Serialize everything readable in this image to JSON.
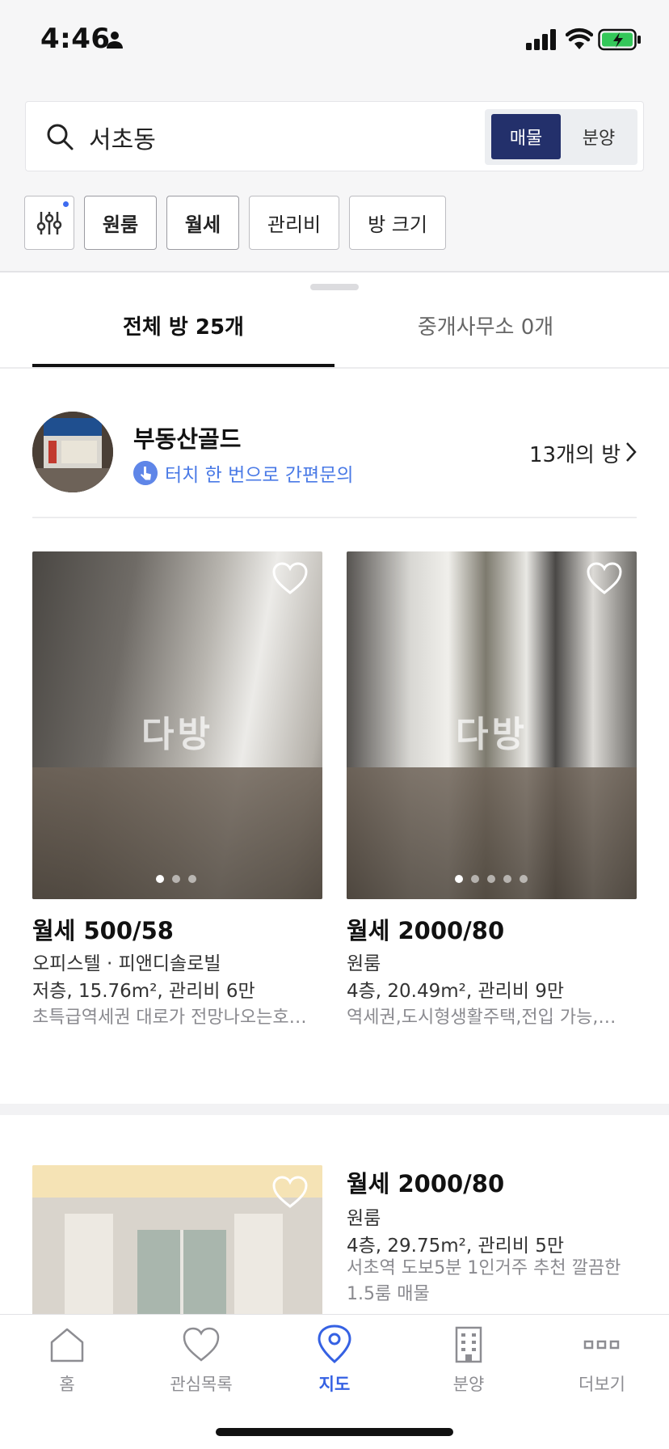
{
  "status_bar": {
    "time": "4:46"
  },
  "search": {
    "query": "서초동",
    "segments": [
      "매물",
      "분양"
    ],
    "active_segment": "매물"
  },
  "filters": [
    "원룸",
    "월세",
    "관리비",
    "방 크기"
  ],
  "tabs": [
    {
      "label": "전체 방 25개",
      "active": true
    },
    {
      "label": "중개사무소 0개",
      "active": false
    }
  ],
  "agency": {
    "avatar_text": "부동산골드",
    "name": "부동산골드",
    "subtitle": "터치 한 번으로 간편문의",
    "count": "13개의 방"
  },
  "listings": [
    {
      "price": "월세 500/58",
      "type": "오피스텔 · 피앤디솔로빌",
      "details": "저층, 15.76m², 관리비 6만",
      "description": "초특급역세권 대로가 전망나오는호…",
      "photo_count": 3,
      "current_photo": 1,
      "watermark": "다방"
    },
    {
      "price": "월세 2000/80",
      "type": "원룸",
      "details": "4층, 20.49m², 관리비 9만",
      "description": "역세권,도시형생활주택,전입 가능,…",
      "photo_count": 5,
      "current_photo": 1,
      "watermark": "다방"
    },
    {
      "price": "월세 2000/80",
      "type": "원룸",
      "details": "4층, 29.75m², 관리비 5만",
      "description": "서초역 도보5분 1인거주 추천 깔끔한 1.5룸 매물"
    }
  ],
  "bottom_nav": [
    {
      "label": "홈",
      "icon": "home-icon"
    },
    {
      "label": "관심목록",
      "icon": "heart-icon"
    },
    {
      "label": "지도",
      "icon": "map-pin-icon",
      "active": true
    },
    {
      "label": "분양",
      "icon": "building-icon"
    },
    {
      "label": "더보기",
      "icon": "more-icon"
    }
  ],
  "colors": {
    "accent": "#3561e3",
    "segment_active": "#23306b",
    "link": "#4a7ae6"
  }
}
